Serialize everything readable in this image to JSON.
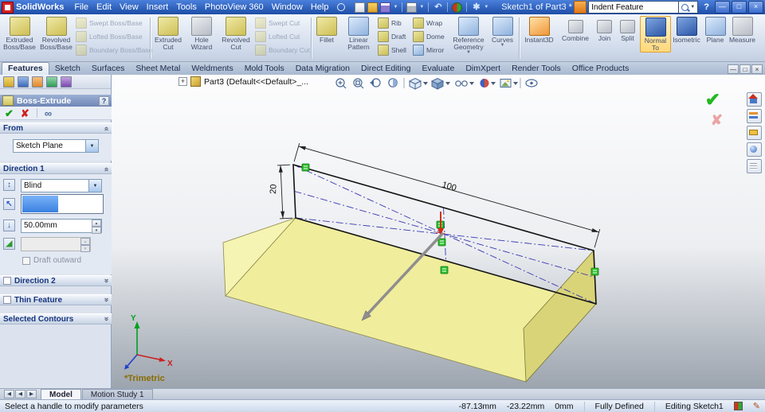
{
  "title_bar": {
    "app_name": "SolidWorks",
    "menus": [
      "File",
      "Edit",
      "View",
      "Insert",
      "Tools",
      "PhotoView 360",
      "Window",
      "Help"
    ],
    "document_title": "Sketch1 of Part3 *",
    "search": {
      "value": "Indent Feature"
    },
    "help_label": "?"
  },
  "ribbon": {
    "items": [
      "Extruded Boss/Base",
      "Revolved Boss/Base",
      "Swept Boss/Base",
      "Lofted Boss/Base",
      "Boundary Boss/Base",
      "Extruded Cut",
      "Hole Wizard",
      "Revolved Cut",
      "Swept Cut",
      "Lofted Cut",
      "Boundary Cut",
      "Fillet",
      "Linear Pattern",
      "Rib",
      "Draft",
      "Shell",
      "Wrap",
      "Dome",
      "Mirror",
      "Reference Geometry",
      "Curves",
      "Instant3D",
      "Combine",
      "Join",
      "Split",
      "Normal To",
      "Isometric",
      "Plane",
      "Measure"
    ]
  },
  "feature_tabs": {
    "tabs": [
      "Features",
      "Sketch",
      "Surfaces",
      "Sheet Metal",
      "Weldments",
      "Mold Tools",
      "Data Migration",
      "Direct Editing",
      "Evaluate",
      "DimXpert",
      "Render Tools",
      "Office Products"
    ]
  },
  "property_panel": {
    "title": "Boss-Extrude",
    "help": "?",
    "sections": {
      "from": {
        "label": "From",
        "value": "Sketch Plane"
      },
      "direction1": {
        "label": "Direction 1",
        "end_condition": "Blind",
        "depth": "50.00mm",
        "draft_checkbox": "Draft outward"
      },
      "direction2": {
        "label": "Direction 2"
      },
      "thin_feature": {
        "label": "Thin Feature"
      },
      "selected_contours": {
        "label": "Selected Contours"
      }
    }
  },
  "viewport": {
    "tree_label": "Part3 (Default<<Default>_...",
    "dim_width": "100",
    "dim_height": "20",
    "axis_x": "X",
    "axis_y": "Y",
    "view_name": "*Trimetric"
  },
  "model_tabs": {
    "tabs": [
      "Model",
      "Motion Study 1"
    ]
  },
  "status_bar": {
    "message": "Select a handle to modify parameters",
    "x": "-87.13mm",
    "y": "-23.22mm",
    "z": "0mm",
    "state": "Fully Defined",
    "mode": "Editing Sketch1"
  },
  "glyphs": {
    "ok_check": "✔",
    "cancel_x": "✘",
    "preview_glasses": "∞",
    "combo_arrow": "▼",
    "spin_up": "▲",
    "spin_down": "▼",
    "chevron": "«",
    "expander_plus": "+",
    "nav_left": "◀",
    "nav_right": "▶",
    "minimize": "—",
    "restore": "□",
    "close": "×",
    "undo_arrow": "↶",
    "reverse_direction": "↕",
    "direction_ref": "↖",
    "depth_arrow": "↓",
    "draft_icon": "◢",
    "pencil": "✎"
  }
}
